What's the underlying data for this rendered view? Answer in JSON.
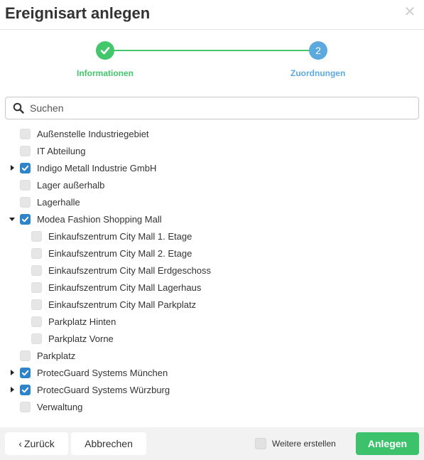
{
  "dialog": {
    "title": "Ereignisart anlegen",
    "close_glyph": "✕"
  },
  "stepper": {
    "steps": [
      {
        "label": "Informationen",
        "state": "completed",
        "number": "1"
      },
      {
        "label": "Zuordnungen",
        "state": "active",
        "number": "2"
      }
    ],
    "colors": {
      "completed": "#43c66c",
      "active": "#5ca9e0"
    }
  },
  "search": {
    "placeholder": "Suchen",
    "value": ""
  },
  "tree": {
    "items": [
      {
        "label": "Außenstelle Industriegebiet",
        "level": 0,
        "checked": false,
        "expander": "none"
      },
      {
        "label": "IT Abteilung",
        "level": 0,
        "checked": false,
        "expander": "none"
      },
      {
        "label": "Indigo Metall Industrie GmbH",
        "level": 0,
        "checked": true,
        "expander": "collapsed"
      },
      {
        "label": "Lager außerhalb",
        "level": 0,
        "checked": false,
        "expander": "none"
      },
      {
        "label": "Lagerhalle",
        "level": 0,
        "checked": false,
        "expander": "none"
      },
      {
        "label": "Modea Fashion Shopping Mall",
        "level": 0,
        "checked": true,
        "expander": "expanded"
      },
      {
        "label": "Einkaufszentrum City Mall 1. Etage",
        "level": 1,
        "checked": false,
        "expander": "none"
      },
      {
        "label": "Einkaufszentrum City Mall 2. Etage",
        "level": 1,
        "checked": false,
        "expander": "none"
      },
      {
        "label": "Einkaufszentrum City Mall Erdgeschoss",
        "level": 1,
        "checked": false,
        "expander": "none"
      },
      {
        "label": "Einkaufszentrum City Mall Lagerhaus",
        "level": 1,
        "checked": false,
        "expander": "none"
      },
      {
        "label": "Einkaufszentrum City Mall Parkplatz",
        "level": 1,
        "checked": false,
        "expander": "none"
      },
      {
        "label": "Parkplatz Hinten",
        "level": 1,
        "checked": false,
        "expander": "none"
      },
      {
        "label": "Parkplatz Vorne",
        "level": 1,
        "checked": false,
        "expander": "none"
      },
      {
        "label": "Parkplatz",
        "level": 0,
        "checked": false,
        "expander": "none"
      },
      {
        "label": "ProtecGuard Systems München",
        "level": 0,
        "checked": true,
        "expander": "collapsed"
      },
      {
        "label": "ProtecGuard Systems Würzburg",
        "level": 0,
        "checked": true,
        "expander": "collapsed"
      },
      {
        "label": "Verwaltung",
        "level": 0,
        "checked": false,
        "expander": "none"
      }
    ]
  },
  "footer": {
    "back_label": "Zurück",
    "back_glyph": "‹",
    "cancel_label": "Abbrechen",
    "more_label": "Weitere erstellen",
    "more_checked": false,
    "create_label": "Anlegen"
  },
  "colors": {
    "checkbox_checked": "#2f83c8",
    "checkbox_unchecked": "#e6e6e6",
    "create_button": "#3cc26b"
  }
}
